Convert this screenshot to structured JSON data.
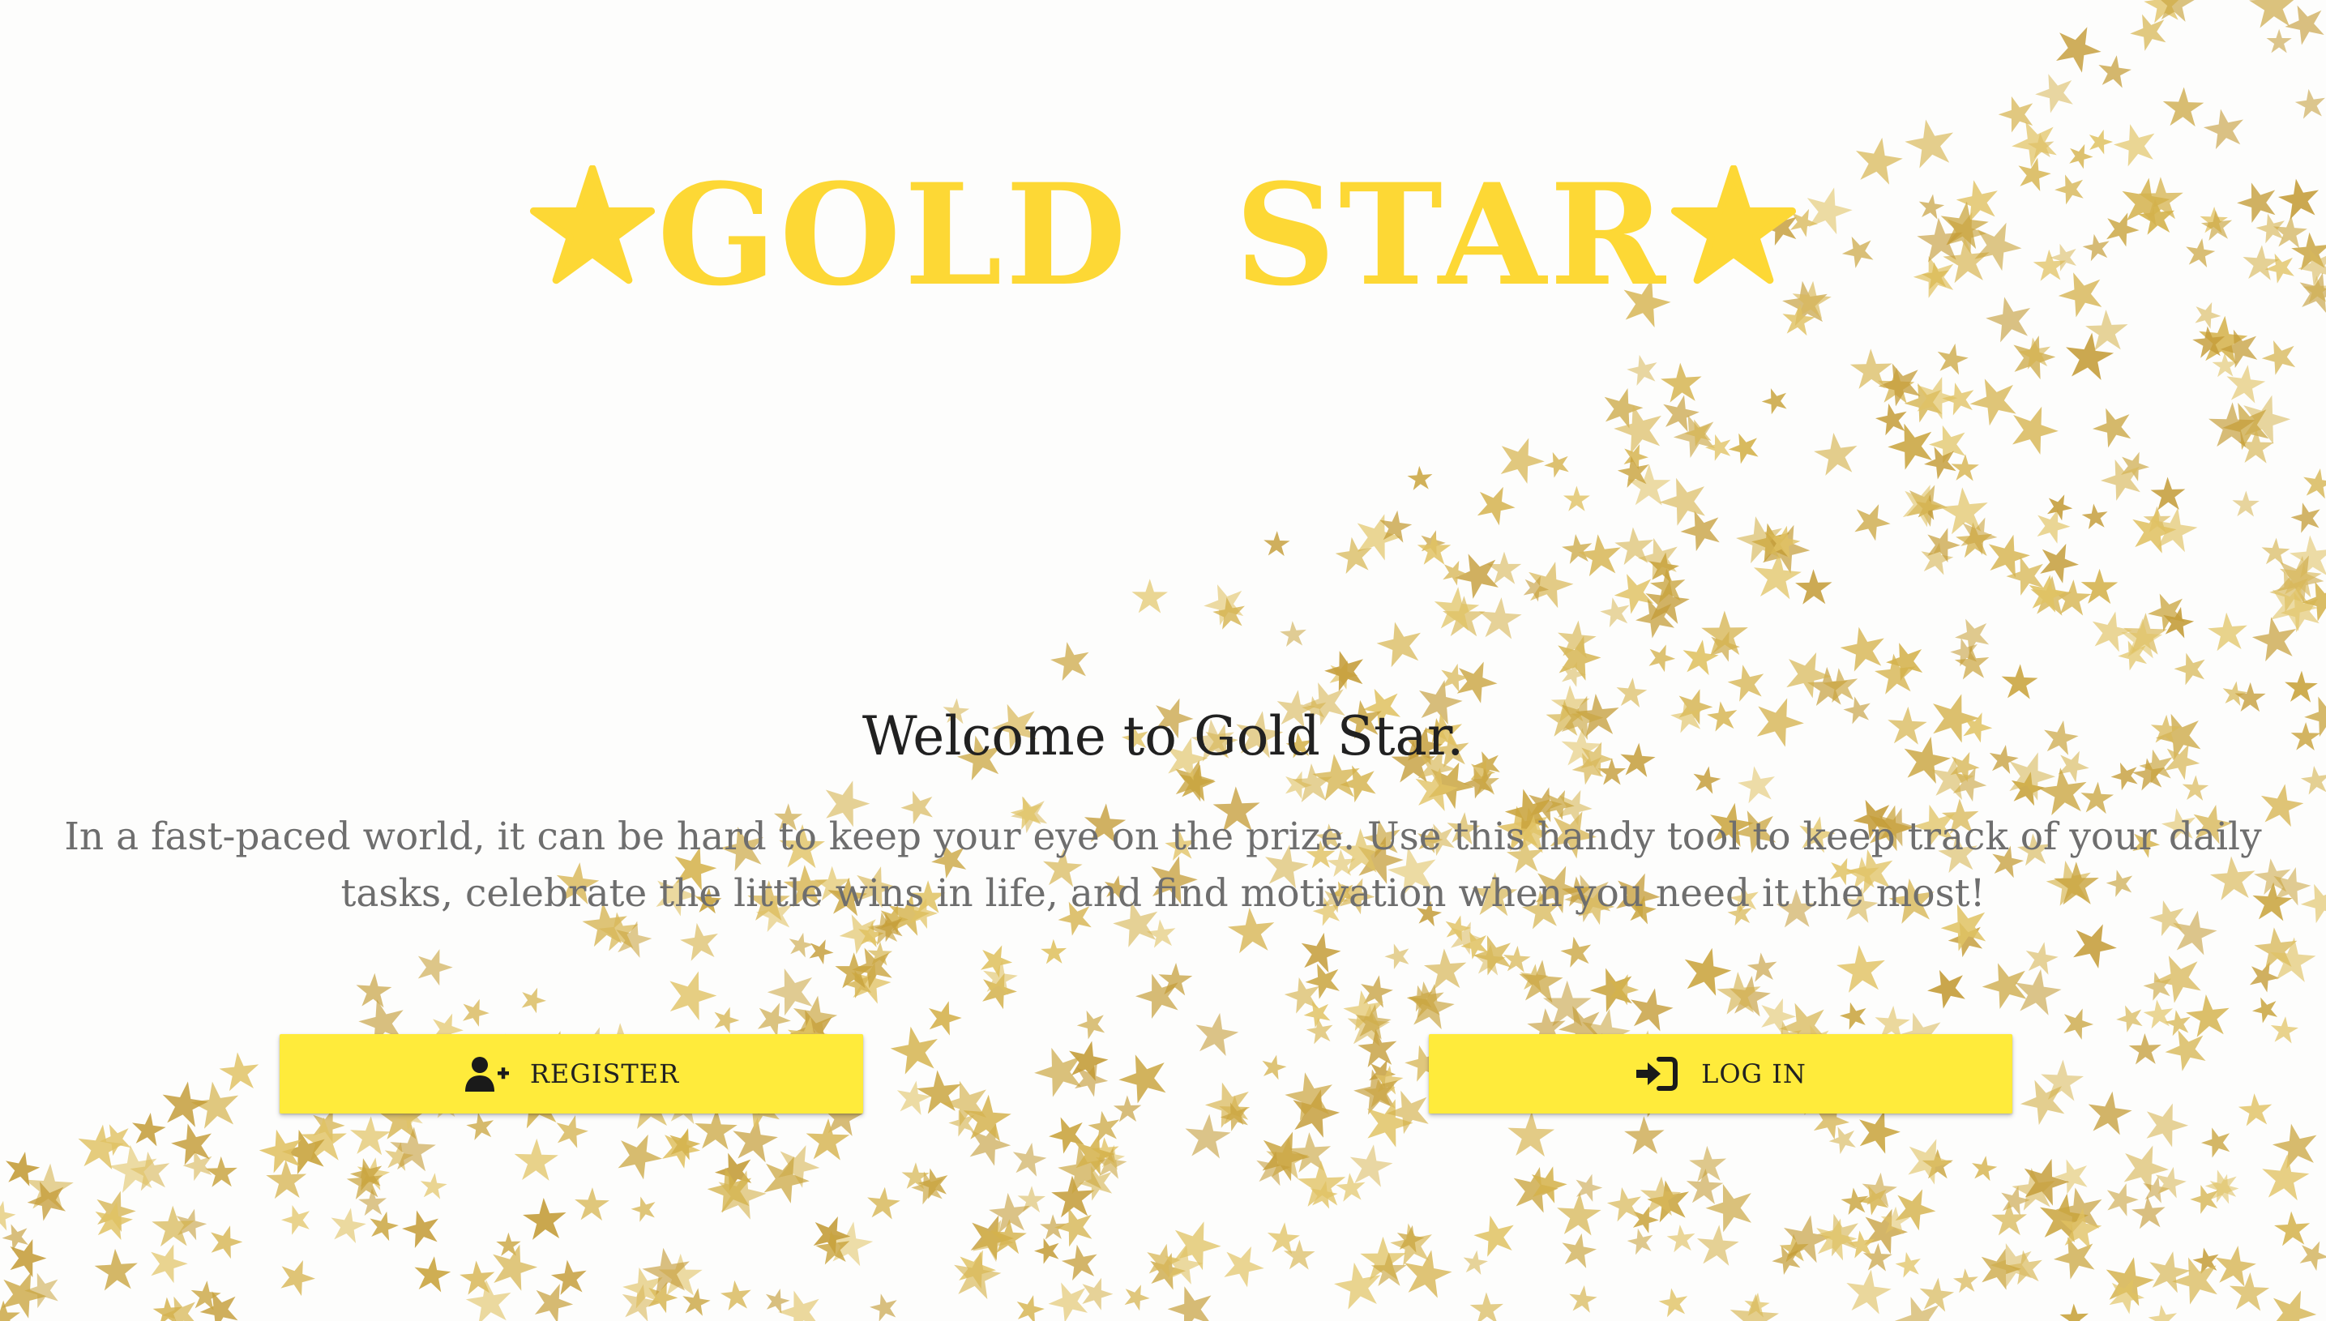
{
  "logo": {
    "word1": "GOLD",
    "word2": "STAR",
    "left_icon": "star-icon",
    "right_icon": "star-icon",
    "color": "#fdd835"
  },
  "welcome": {
    "heading": "Welcome to Gold Star.",
    "intro": "In a fast-paced world, it can be hard to keep your eye on the prize. Use this handy tool to keep track of your daily tasks, celebrate the little wins in life, and find motivation when you need it the most!"
  },
  "actions": {
    "register": {
      "label": "REGISTER",
      "icon": "user-plus-icon"
    },
    "login": {
      "label": "LOG IN",
      "icon": "sign-in-icon"
    },
    "button_color": "#ffeb3b"
  },
  "background": {
    "decoration": "gold-glitter-stars",
    "star_color": "#d4b24c"
  }
}
